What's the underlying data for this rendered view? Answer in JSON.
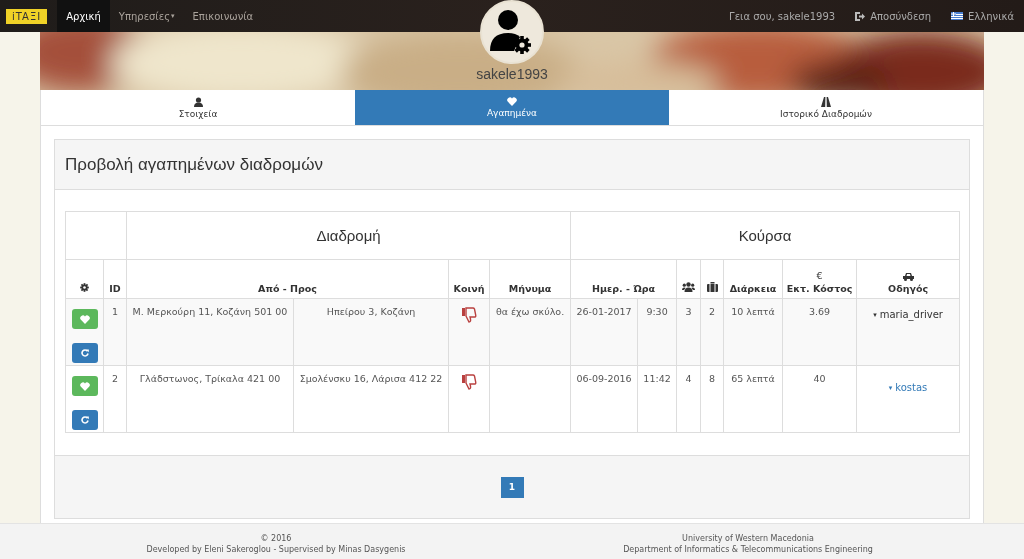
{
  "navbar": {
    "logo": "iTAΞI",
    "items": [
      {
        "label": "Αρχική",
        "selected": true
      },
      {
        "label": "Υπηρεσίες",
        "selected": false,
        "caret": "▾"
      },
      {
        "label": "Επικοινωνία",
        "selected": false
      }
    ],
    "greeting": "Γεια σου, sakele1993",
    "logout": "Αποσύνδεση",
    "language": "Ελληνικά"
  },
  "profile": {
    "username": "sakele1993"
  },
  "tabs": [
    {
      "label": "Στοιχεία",
      "selected": false
    },
    {
      "label": "Αγαπημένα",
      "selected": true
    },
    {
      "label": "Ιστορικό Διαδρομών",
      "selected": false
    }
  ],
  "panel": {
    "title": "Προβολή αγαπημένων διαδρομών",
    "table": {
      "groups": [
        "Διαδρομή",
        "Κούρσα"
      ],
      "columns": [
        "ID",
        "Από - Προς",
        "Κοινή",
        "Μήνυμα",
        "Ημερ. - Ώρα",
        "Διάρκεια",
        "€",
        "Εκτ. Κόστος",
        "Οδηγός"
      ],
      "rows": [
        {
          "id": "1",
          "from": "Μ. Μερκούρη 11, Κοζάνη 501 00",
          "to": "Ηπείρου 3, Κοζάνη",
          "shared": false,
          "message": "θα έχω σκύλο.",
          "date": "26-01-2017",
          "time": "9:30",
          "passengers": "3",
          "luggage": "2",
          "duration": "10 λεπτά",
          "cost": "3.69",
          "driver_caret": "▾",
          "driver": "maria_driver",
          "hovered": true
        },
        {
          "id": "2",
          "from": "Γλάδστωνος, Τρίκαλα 421 00",
          "to": "Σμολένσκυ 16, Λάρισα 412 22",
          "shared": false,
          "date": "06-09-2016",
          "time": "11:42",
          "passengers": "4",
          "luggage": "8",
          "duration": "65 λεπτά",
          "cost": "40",
          "driver_caret": "▾",
          "driver": "kostas",
          "hovered": false
        }
      ]
    },
    "pages": [
      {
        "label": "1",
        "selected": true
      }
    ]
  },
  "footer": {
    "left": [
      "© 2016",
      "Developed by Eleni Sakeroglou - Supervised by Minas Dasygenis"
    ],
    "right": [
      "University of Western Macedonia",
      "Department of Informatics & Telecommunications Engineering"
    ]
  }
}
